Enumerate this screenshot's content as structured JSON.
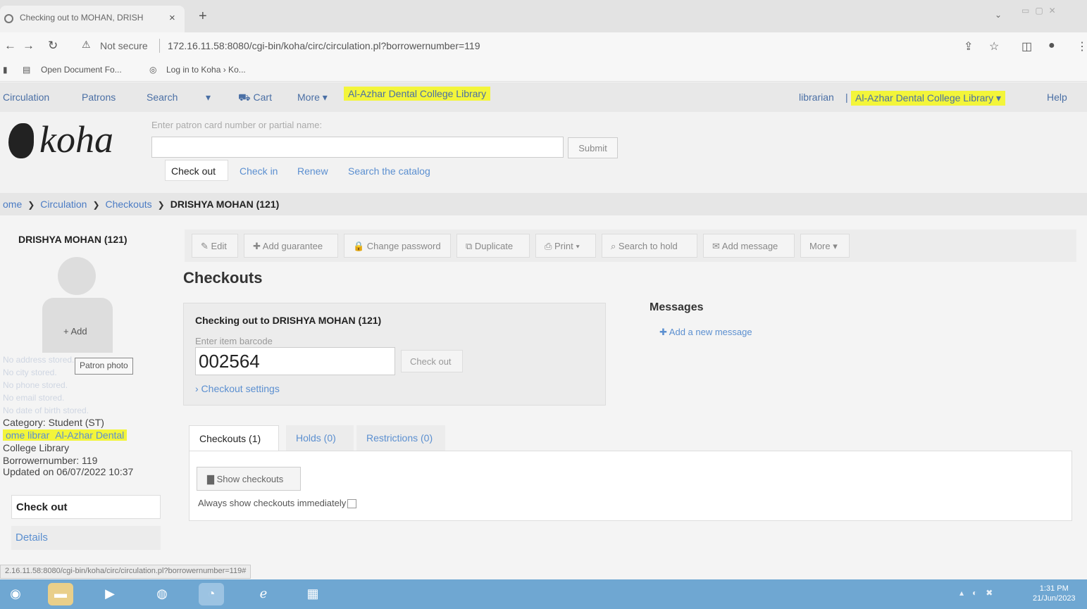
{
  "browser": {
    "tab_title": "Checking out to MOHAN, DRISH",
    "tab_close": "×",
    "new_tab": "+",
    "tab_dropdown": "⌄",
    "not_secure": "Not secure",
    "url": "172.16.11.58:8080/cgi-bin/koha/circ/circulation.pl?borrowernumber=119",
    "bookmarks": [
      "Open Document Fo...",
      "Log in to Koha › Ko..."
    ],
    "status_url": "2.16.11.58:8080/cgi-bin/koha/circ/circulation.pl?borrowernumber=119#"
  },
  "navbar": {
    "items": [
      "Circulation",
      "Patrons",
      "Search",
      "▾",
      "Cart",
      "More ▾"
    ],
    "library_banner": "Al-Azhar Dental College Library",
    "user": "librarian",
    "user_sep": "|",
    "branch": "Al-Azhar Dental College Library ▾",
    "help": "Help"
  },
  "header": {
    "logo": "koha",
    "search_label": "Enter patron card number or partial name:",
    "submit": "Submit",
    "subtabs": [
      "Check out",
      "Check in",
      "Renew",
      "Search the catalog"
    ]
  },
  "breadcrumb": {
    "home": "ome",
    "circulation": "Circulation",
    "checkouts": "Checkouts",
    "current": "DRISHYA MOHAN (121)"
  },
  "patron": {
    "name": "DRISHYA MOHAN (121)",
    "photo_add": "+ Add",
    "photo_tooltip": "Patron photo",
    "faint_lines": [
      "No address stored.",
      "No city stored.",
      "No phone stored.",
      "No email stored.",
      "No date of birth stored."
    ],
    "category": "Category: Student (ST)",
    "home_library_label": "ome librar",
    "home_library_value": "Al-Azhar Dental",
    "home_library_cont": "College Library",
    "borrowernumber": "Borrowernumber: 119",
    "updated": "Updated on 06/07/2022 10:37"
  },
  "sidebar_menu": {
    "active": "Check out",
    "details": "Details"
  },
  "toolbar": {
    "buttons": [
      "✎ Edit",
      "✚ Add guarantee",
      "🔒 Change password",
      "⧉ Duplicate",
      "⎙ Print ▾",
      "⌕ Search to hold",
      "✉ Add message",
      "More ▾"
    ]
  },
  "main": {
    "title": "Checkouts",
    "checkout_box": {
      "title": "Checking out to DRISHYA MOHAN (121)",
      "barcode_label": "Enter item barcode",
      "barcode_value": "002564",
      "button": "Check out",
      "settings": "› Checkout settings"
    },
    "messages_heading": "Messages",
    "add_message": "✚ Add a new message",
    "tabs": [
      "Checkouts (1)",
      "Holds (0)",
      "Restrictions (0)"
    ],
    "show_checkouts": "Show checkouts",
    "always_show": "Always show checkouts immediately"
  },
  "taskbar": {
    "clock_time": "1:31 PM",
    "clock_date": "21/Jun/2023"
  },
  "colors": {
    "link": "#5b8fd0",
    "highlight": "#f3f53a",
    "taskbar": "#6fa7d2"
  }
}
